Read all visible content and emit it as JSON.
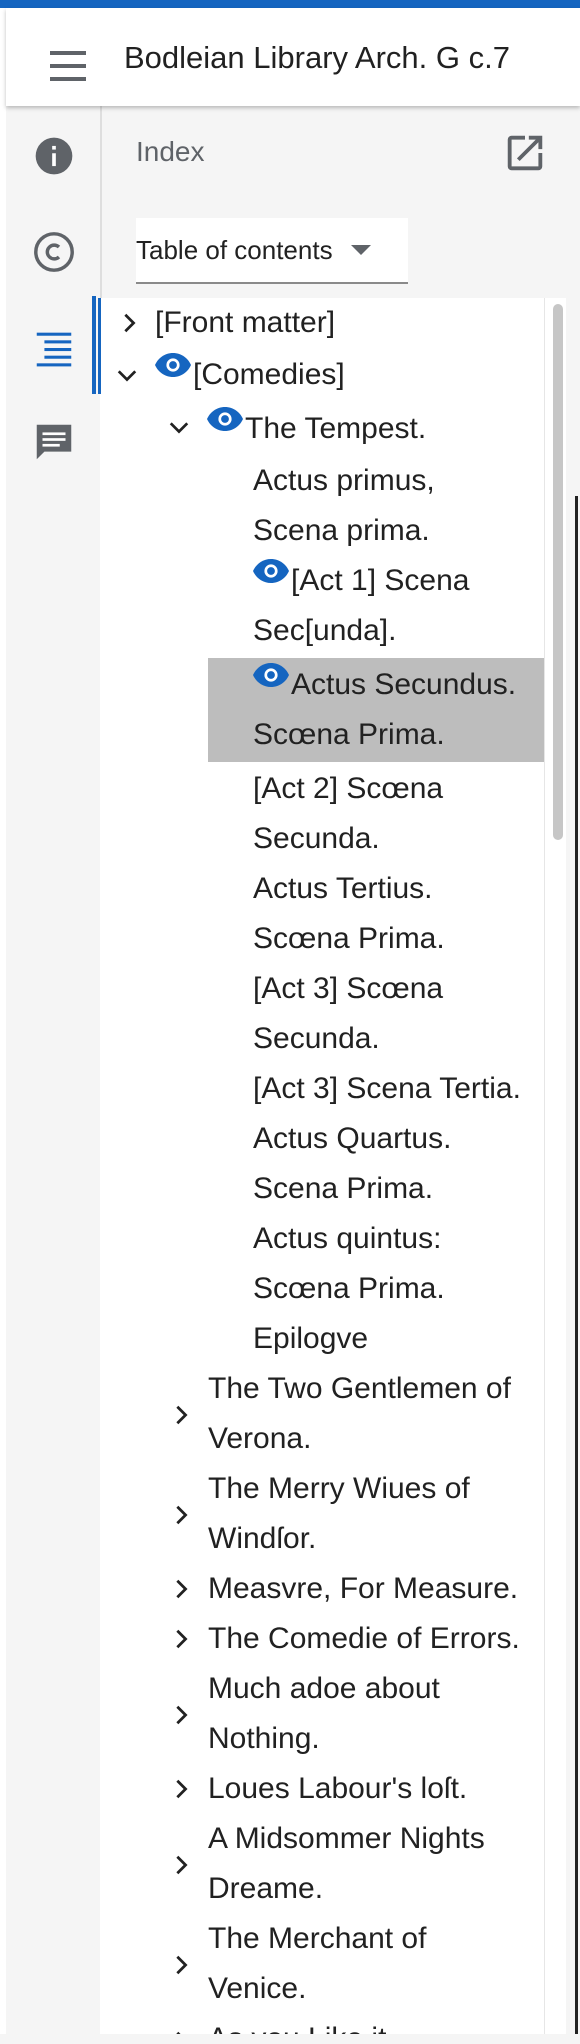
{
  "header": {
    "title": "Bodleian Library Arch. G c.7"
  },
  "sidebar": {
    "buttons": [
      {
        "name": "info-icon"
      },
      {
        "name": "copyright-icon"
      },
      {
        "name": "toc-icon"
      },
      {
        "name": "comment-icon"
      }
    ]
  },
  "panel": {
    "title": "Index",
    "select_label": "Table of contents"
  },
  "toc": {
    "front_matter": "[Front matter]",
    "comedies": "[Comedies]",
    "tempest": "The Tempest.",
    "scenes": [
      "Actus primus, Scena prima.",
      "[Act 1] Scena Sec[unda].",
      "Actus Secundus. Scœna Prima.",
      "[Act 2] Scœna Secunda.",
      "Actus Tertius. Scœna Prima.",
      "[Act 3] Scœna Secunda.",
      "[Act 3] Scena Tertia.",
      "Actus Quartus. Scena Prima.",
      "Actus quintus: Scœna Prima.",
      "Epilogve"
    ],
    "plays": [
      "The Two Gentlemen of Verona.",
      "The Merry Wiues of Windſor.",
      "Measvre, For Measure.",
      "The Comedie of Errors.",
      "Much adoe about Nothing.",
      "Loues Labour's loſt.",
      "A Midsommer Nights Dreame.",
      "The Merchant of Venice.",
      "As you Like it."
    ]
  },
  "colors": {
    "accent": "#1565c0",
    "selected_bg": "#bdbdbd",
    "icon_grey": "#5f6368"
  }
}
